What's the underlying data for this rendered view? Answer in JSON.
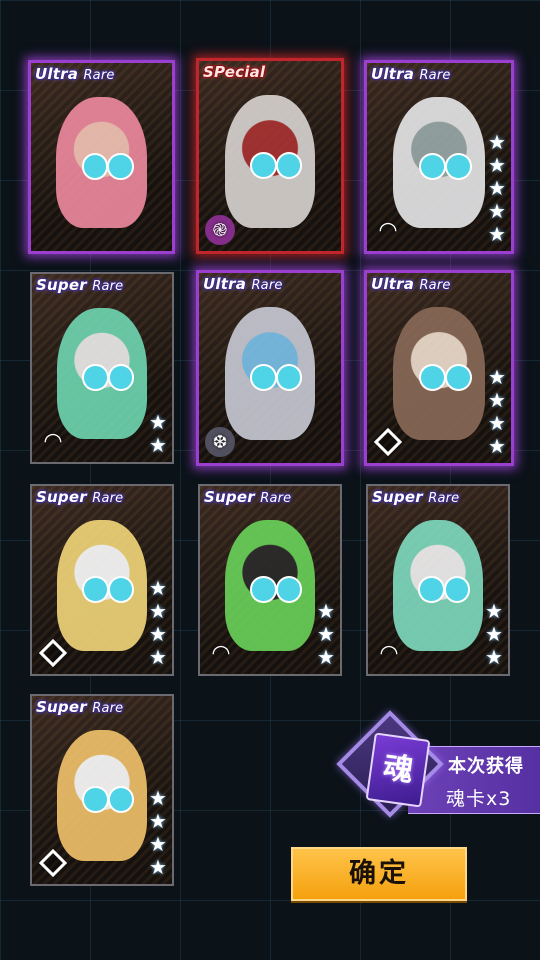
{
  "cards": [
    {
      "rarity_a": "Ultra",
      "rarity_b": "Rare",
      "tier": "ultra",
      "stars": 0,
      "badge": "",
      "badge_icon": ""
    },
    {
      "rarity_a": "SPecial",
      "rarity_b": "",
      "tier": "special",
      "stars": 0,
      "badge": "spiral",
      "badge_icon": "spiral-icon"
    },
    {
      "rarity_a": "Ultra",
      "rarity_b": "Rare",
      "tier": "ultra",
      "stars": 5,
      "badge": "wifi",
      "badge_icon": "wifi-icon"
    },
    {
      "rarity_a": "Super",
      "rarity_b": "Rare",
      "tier": "super",
      "stars": 2,
      "badge": "wifi",
      "badge_icon": "wifi-icon"
    },
    {
      "rarity_a": "Ultra",
      "rarity_b": "Rare",
      "tier": "ultra",
      "stars": 0,
      "badge": "drop",
      "badge_icon": "drop-icon"
    },
    {
      "rarity_a": "Ultra",
      "rarity_b": "Rare",
      "tier": "ultra",
      "stars": 4,
      "badge": "diamond",
      "badge_icon": "diamond-icon"
    },
    {
      "rarity_a": "Super",
      "rarity_b": "Rare",
      "tier": "super",
      "stars": 4,
      "badge": "diamond",
      "badge_icon": "diamond-icon"
    },
    {
      "rarity_a": "Super",
      "rarity_b": "Rare",
      "tier": "super",
      "stars": 3,
      "badge": "wifi",
      "badge_icon": "wifi-icon"
    },
    {
      "rarity_a": "Super",
      "rarity_b": "Rare",
      "tier": "super",
      "stars": 3,
      "badge": "wifi",
      "badge_icon": "wifi-icon"
    },
    {
      "rarity_a": "Super",
      "rarity_b": "Rare",
      "tier": "super",
      "stars": 4,
      "badge": "diamond",
      "badge_icon": "diamond-icon"
    }
  ],
  "reward": {
    "title": "本次获得",
    "count": "魂卡x3",
    "card_glyph": "魂"
  },
  "confirm_label": "确定"
}
